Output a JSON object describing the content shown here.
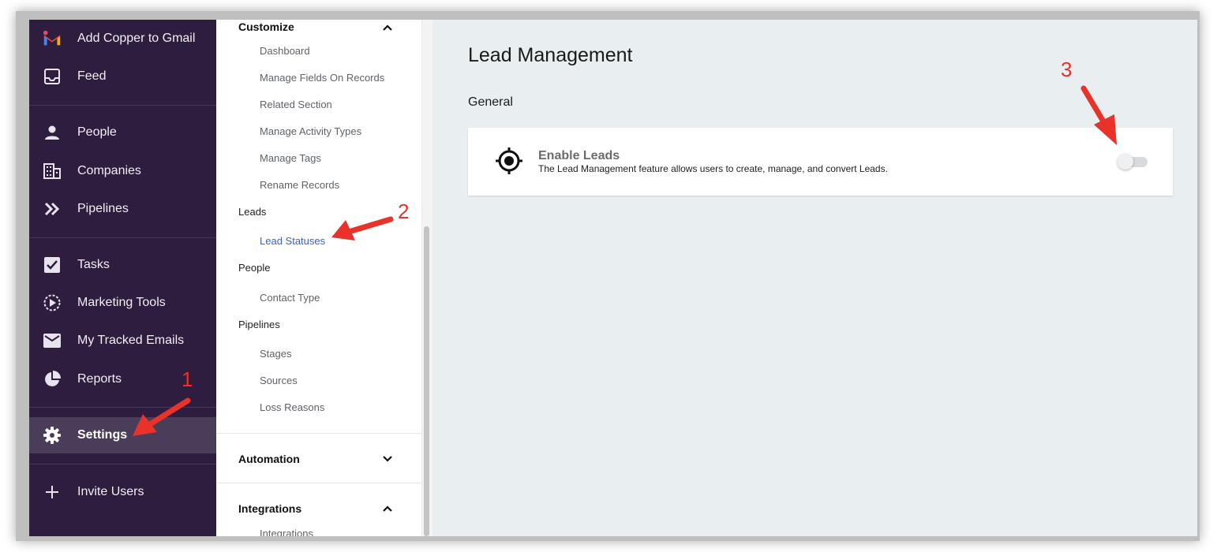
{
  "nav": {
    "items": [
      {
        "label": "Add Copper to Gmail",
        "icon": "gmail-icon"
      },
      {
        "label": "Feed",
        "icon": "inbox-icon"
      },
      {
        "label": "People",
        "icon": "person-icon"
      },
      {
        "label": "Companies",
        "icon": "building-icon"
      },
      {
        "label": "Pipelines",
        "icon": "double-chevron-icon"
      },
      {
        "label": "Tasks",
        "icon": "checkbox-icon"
      },
      {
        "label": "Marketing Tools",
        "icon": "play-circle-icon"
      },
      {
        "label": "My Tracked Emails",
        "icon": "envelope-icon"
      },
      {
        "label": "Reports",
        "icon": "pie-chart-icon"
      },
      {
        "label": "Settings",
        "icon": "gear-icon"
      },
      {
        "label": "Invite Users",
        "icon": "plus-icon"
      }
    ],
    "active": "Settings",
    "bg_color": "#2e1d3e"
  },
  "submenu": {
    "customize": {
      "label": "Customize"
    },
    "items": {
      "dashboard": "Dashboard",
      "manage_fields": "Manage Fields On Records",
      "related_section": "Related Section",
      "manage_activity_types": "Manage Activity Types",
      "manage_tags": "Manage Tags",
      "rename_records": "Rename Records"
    },
    "leads": {
      "label": "Leads",
      "lead_statuses": "Lead Statuses"
    },
    "people": {
      "label": "People",
      "contact_type": "Contact Type"
    },
    "pipelines": {
      "label": "Pipelines",
      "stages": "Stages",
      "sources": "Sources",
      "loss_reasons": "Loss Reasons"
    },
    "automation": {
      "label": "Automation"
    },
    "integrations": {
      "label": "Integrations",
      "integrations_item": "Integrations"
    },
    "active_color": "#3b63c4"
  },
  "main": {
    "title": "Lead Management",
    "section": "General",
    "card": {
      "title": "Enable Leads",
      "description": "The Lead Management feature allows users to create, manage, and convert Leads.",
      "icon": "target-icon",
      "toggle_on": false
    }
  },
  "annotations": [
    "1",
    "2",
    "3"
  ],
  "annotation_color": "#e8322a"
}
